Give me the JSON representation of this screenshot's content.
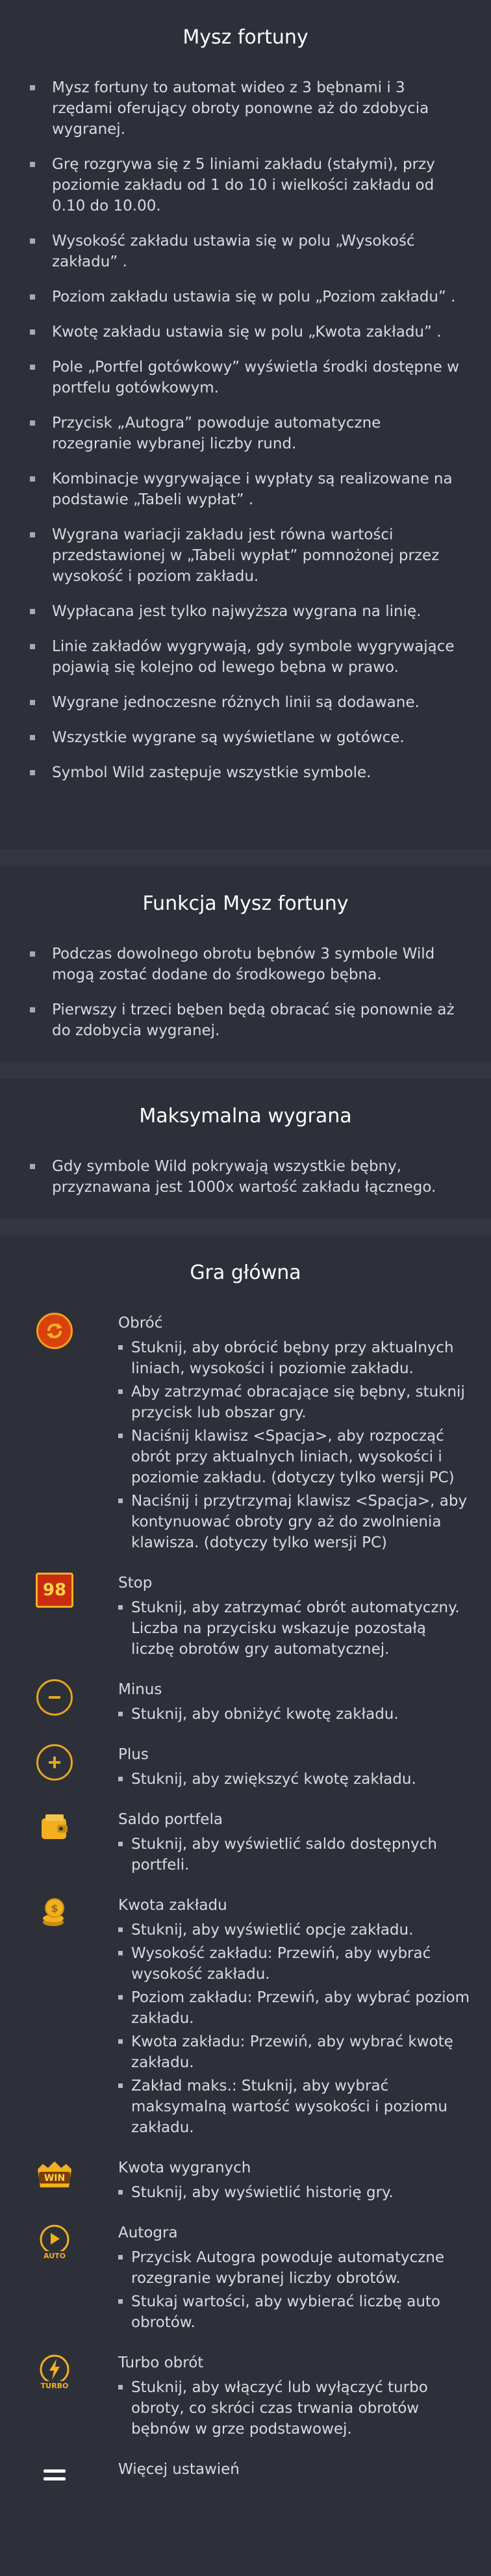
{
  "section1": {
    "title": "Mysz fortuny",
    "items": [
      "Mysz fortuny to automat wideo z 3 bębnami i 3 rzędami oferujący obroty ponowne aż do zdobycia wygranej.",
      "Grę rozgrywa się z 5 liniami zakładu (stałymi), przy poziomie zakładu od 1 do 10 i wielkości zakładu od 0.10 do 10.00.",
      "Wysokość zakładu ustawia się w polu „Wysokość zakładu”  .",
      "Poziom zakładu ustawia się w polu „Poziom zakładu”  .",
      "Kwotę zakładu ustawia się w polu „Kwota zakładu”  .",
      "Pole „Portfel gotówkowy”   wyświetla środki dostępne w portfelu gotówkowym.",
      "Przycisk „Autogra”   powoduje automatyczne rozegranie wybranej liczby rund.",
      "Kombinacje wygrywające i wypłaty są realizowane na podstawie „Tabeli wypłat”  .",
      "Wygrana wariacji zakładu jest równa wartości przedstawionej w „Tabeli wypłat”   pomnożonej przez wysokość i poziom zakładu.",
      "Wypłacana jest tylko najwyższa wygrana na linię.",
      "Linie zakładów wygrywają, gdy symbole wygrywające pojawią się kolejno od lewego bębna w prawo.",
      "Wygrane jednoczesne różnych linii są dodawane.",
      "Wszystkie wygrane są wyświetlane w gotówce.",
      "Symbol Wild zastępuje wszystkie symbole."
    ]
  },
  "section2": {
    "title": "Funkcja Mysz fortuny",
    "items": [
      "Podczas dowolnego obrotu bębnów 3 symbole Wild mogą zostać dodane do środkowego bębna.",
      "Pierwszy i trzeci bęben będą obracać się ponownie aż do zdobycia wygranej."
    ]
  },
  "section3": {
    "title": "Maksymalna wygrana",
    "items": [
      "Gdy symbole Wild pokrywają wszystkie bębny, przyznawana jest 1000x wartość zakładu łącznego."
    ]
  },
  "section4": {
    "title": "Gra główna",
    "entries": [
      {
        "icon": "spin-icon",
        "title": "Obróć",
        "items": [
          "Stuknij, aby obrócić bębny przy aktualnych liniach, wysokości i poziomie zakładu.",
          "Aby zatrzymać obracające się bębny, stuknij przycisk lub obszar gry.",
          "Naciśnij klawisz <Spacja>, aby rozpocząć obrót przy aktualnych liniach, wysokości i poziomie zakładu. (dotyczy tylko wersji PC)",
          "Naciśnij i przytrzymaj klawisz <Spacja>, aby kontynuować obroty gry aż do zwolnienia klawisza. (dotyczy tylko wersji PC)"
        ]
      },
      {
        "icon": "stop-counter-icon",
        "icon_text": "98",
        "title": "Stop",
        "items": [
          "Stuknij, aby zatrzymać obrót automatyczny. Liczba na przycisku wskazuje pozostałą liczbę obrotów gry automatycznej."
        ]
      },
      {
        "icon": "minus-icon",
        "title": "Minus",
        "items": [
          "Stuknij, aby obniżyć kwotę zakładu."
        ]
      },
      {
        "icon": "plus-icon",
        "title": "Plus",
        "items": [
          "Stuknij, aby zwiększyć kwotę zakładu."
        ]
      },
      {
        "icon": "wallet-icon",
        "title": "Saldo portfela",
        "items": [
          "Stuknij, aby wyświetlić saldo dostępnych portfeli."
        ]
      },
      {
        "icon": "coins-icon",
        "title": "Kwota zakładu",
        "items": [
          "Stuknij, aby wyświetlić opcje zakładu.",
          "Wysokość zakładu: Przewiń, aby wybrać wysokość zakładu.",
          "Poziom zakładu: Przewiń, aby wybrać poziom zakładu.",
          "Kwota zakładu: Przewiń, aby wybrać kwotę zakładu.",
          "Zakład maks.: Stuknij, aby wybrać maksymalną wartość wysokości i poziomu zakładu."
        ]
      },
      {
        "icon": "win-icon",
        "icon_text": "WIN",
        "title": "Kwota wygranych",
        "items": [
          "Stuknij, aby wyświetlić historię gry."
        ]
      },
      {
        "icon": "autoplay-icon",
        "icon_text": "AUTO",
        "title": "Autogra",
        "items": [
          "Przycisk Autogra powoduje automatyczne rozegranie wybranej liczby obrotów.",
          "Stukaj wartości, aby wybierać liczbę auto obrotów."
        ]
      },
      {
        "icon": "turbo-icon",
        "icon_text": "TURBO",
        "title": "Turbo obrót",
        "items": [
          "Stuknij, aby włączyć lub wyłączyć turbo obroty, co skróci czas trwania obrotów bębnów w grze podstawowej."
        ]
      },
      {
        "icon": "menu-icon",
        "title": "Więcej ustawień",
        "items": []
      }
    ]
  },
  "colors": {
    "background": "#2e3039",
    "accent": "#e8a61a",
    "spin_red": "#d8420f",
    "text": "#d9d9e0",
    "title": "#ffffff"
  }
}
